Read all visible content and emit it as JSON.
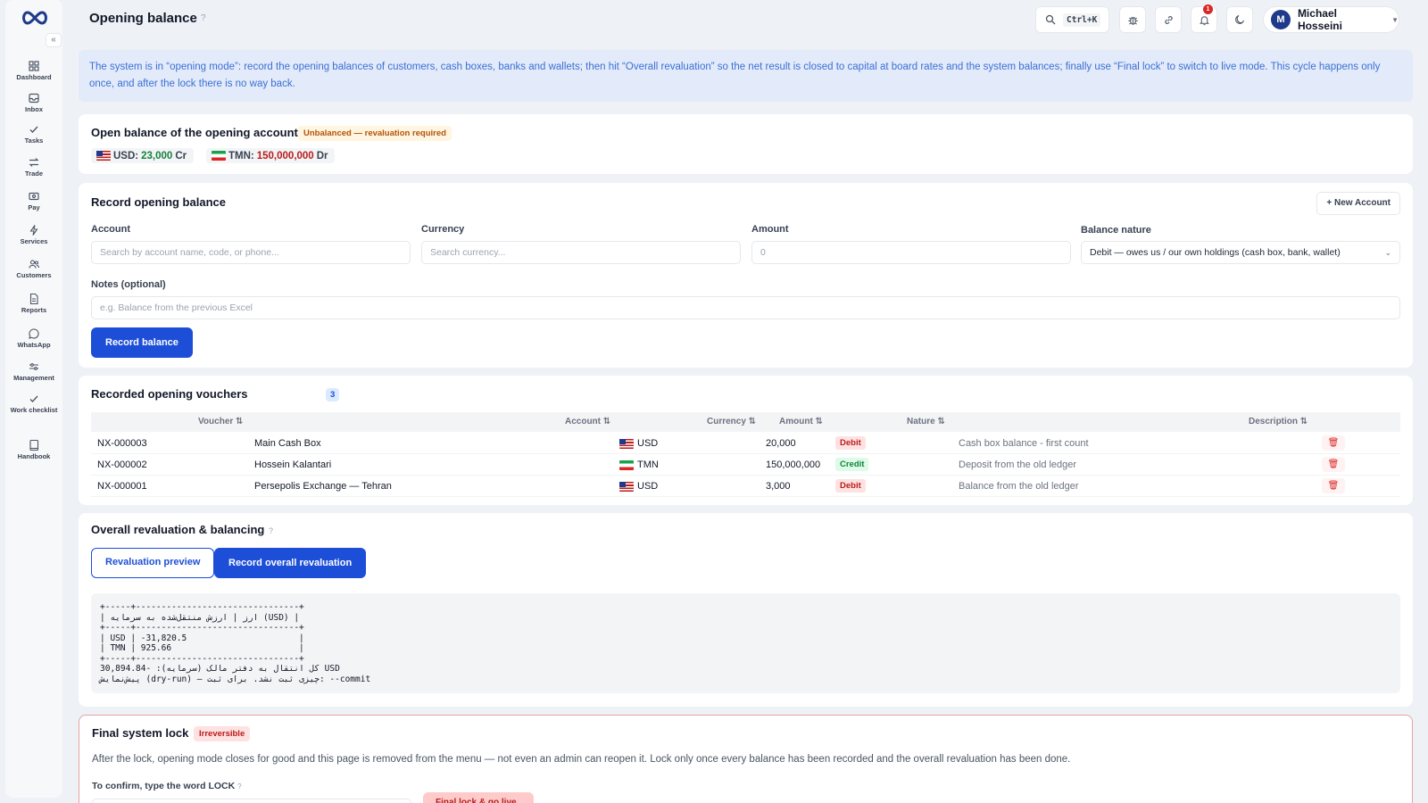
{
  "sidebar": {
    "items": [
      {
        "label": "Dashboard",
        "icon": "grid-icon"
      },
      {
        "label": "Inbox",
        "icon": "inbox-icon"
      },
      {
        "label": "Tasks",
        "icon": "check-icon"
      },
      {
        "label": "Trade",
        "icon": "swap-icon"
      },
      {
        "label": "Pay",
        "icon": "wallet-icon"
      },
      {
        "label": "Services",
        "icon": "bolt-icon"
      },
      {
        "label": "Customers",
        "icon": "users-icon"
      },
      {
        "label": "Reports",
        "icon": "file-icon"
      },
      {
        "label": "WhatsApp",
        "icon": "chat-icon"
      },
      {
        "label": "Management",
        "icon": "sliders-icon"
      },
      {
        "label": "Work checklist",
        "icon": "check-icon"
      },
      {
        "label": "Handbook",
        "icon": "book-icon"
      }
    ]
  },
  "header": {
    "title": "Opening balance",
    "info": "?",
    "search_shortcut": "Ctrl+K",
    "notification_count": "1",
    "user": {
      "initial": "M",
      "name": "Michael Hosseini"
    }
  },
  "banner": {
    "text": "The system is in “opening mode”: record the opening balances of customers, cash boxes, banks and wallets; then hit “Overall revaluation” so the net result is closed to capital at board rates and the system balances; finally use “Final lock” to switch to live mode. This cycle happens only once, and after the lock there is no way back."
  },
  "balance_card": {
    "title": "Open balance of the opening account",
    "status": "Unbalanced — revaluation required",
    "chips": [
      {
        "currency": "USD:",
        "amount": "23,000",
        "side": "Cr"
      },
      {
        "currency": "TMN:",
        "amount": "150,000,000",
        "side": "Dr"
      }
    ]
  },
  "form": {
    "title": "Record opening balance",
    "new_account": "+ New Account",
    "account_label": "Account",
    "account_placeholder": "Search by account name, code, or phone...",
    "currency_label": "Currency",
    "currency_placeholder": "Search currency...",
    "amount_label": "Amount",
    "amount_placeholder": "0",
    "nature_label": "Balance nature",
    "nature_value": "Debit — owes us / our own holdings (cash box, bank, wallet)",
    "notes_label": "Notes (optional)",
    "notes_placeholder": "e.g. Balance from the previous Excel",
    "submit": "Record balance"
  },
  "vouchers": {
    "title": "Recorded opening vouchers",
    "count": "3",
    "headers": {
      "voucher": "Voucher ⇅",
      "account": "Account ⇅",
      "currency": "Currency ⇅",
      "amount": "Amount ⇅",
      "nature": "Nature ⇅",
      "description": "Description ⇅"
    },
    "rows": [
      {
        "voucher": "NX-000003",
        "account": "Main Cash Box",
        "currency": "USD",
        "amount": "20,000",
        "nature": "Debit",
        "description": "Cash box balance - first count"
      },
      {
        "voucher": "NX-000002",
        "account": "Hossein Kalantari",
        "currency": "TMN",
        "amount": "150,000,000",
        "nature": "Credit",
        "description": "Deposit from the old ledger"
      },
      {
        "voucher": "NX-000001",
        "account": "Persepolis Exchange — Tehran",
        "currency": "USD",
        "amount": "3,000",
        "nature": "Debit",
        "description": "Balance from the old ledger"
      }
    ]
  },
  "revaluation": {
    "title": "Overall revaluation & balancing",
    "info": "?",
    "preview_button": "Revaluation preview",
    "record_button": "Record overall revaluation",
    "console": "+-----+--------------------------------+\n| ارز | ارزش منتقل‌شده به سرمایه (USD) |\n+-----+--------------------------------+\n| USD | -31,820.5                      |\n| TMN | 925.66                         |\n+-----+--------------------------------+\nکل انتقال به دفتر مالک (سرمایه): -30,894.84 USD\nپیش‌نمایش (dry-run) — چیزی ثبت نشد. برای ثبت: --commit"
  },
  "lock": {
    "title": "Final system lock",
    "badge": "Irreversible",
    "text": "After the lock, opening mode closes for good and this page is removed from the menu — not even an admin can reopen it. Lock only once every balance has been recorded and the overall revaluation has been done.",
    "confirm_label": "To confirm, type the word LOCK",
    "info": "?",
    "button": "Final lock & go live"
  },
  "colors": {
    "primary": "#1d4ed8",
    "debit": "#b91c1c",
    "credit": "#15803d",
    "warning": "#b45309",
    "banner_bg": "#e3ebfa"
  }
}
